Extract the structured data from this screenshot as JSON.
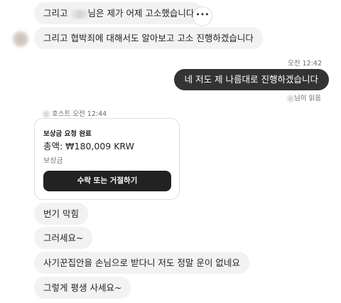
{
  "messages": {
    "m1_prefix": "그리고",
    "m1_suffix": "님은 제가 어제 고소했습니다",
    "m2": "그리고 협박죄에 대해서도 알아보고 고소 진행하겠습니다",
    "sent_time": "오전 12:42",
    "m3": "네 저도 제 나름대로 진행하겠습니다",
    "read_status": "님이 읽음",
    "host_label": "호스트",
    "host_time": "오전 12:44",
    "m4": "번기 막힘",
    "m5": "그러세요~",
    "m6": "사기꾼집안을 손님으로 받다니 저도 정말 운이 없네요",
    "m7": "그렇게 평생 사세요~"
  },
  "card": {
    "title": "보상금 요청 완료",
    "amount": "총액: ₩180,009 KRW",
    "subtitle": "보상금",
    "button_label": "수락 또는 거절하기"
  },
  "more_button": {
    "label": "•••"
  }
}
